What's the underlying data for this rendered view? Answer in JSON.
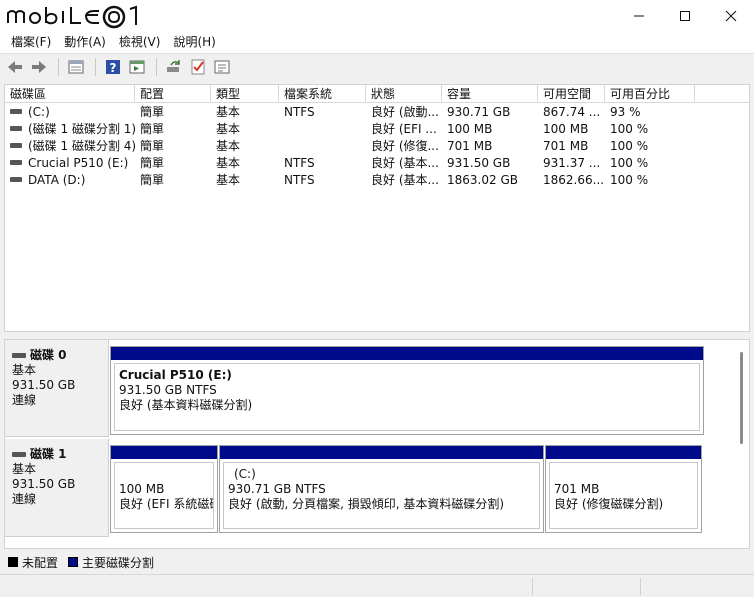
{
  "titlebar": {
    "brand": "mobile01"
  },
  "menu": [
    "檔案(F)",
    "動作(A)",
    "檢視(V)",
    "說明(H)"
  ],
  "toolbar_icons": [
    "back-arrow-icon",
    "forward-arrow-icon",
    "disk-list-icon",
    "help-icon",
    "properties-icon",
    "refresh-disk-icon",
    "check-icon",
    "settings-list-icon"
  ],
  "columns": [
    "磁碟區",
    "配置",
    "類型",
    "檔案系統",
    "狀態",
    "容量",
    "可用空間",
    "可用百分比"
  ],
  "rows": [
    [
      "(C:)",
      "簡單",
      "基本",
      "NTFS",
      "良好 (啟動...",
      "930.71 GB",
      "867.74 ...",
      "93 %"
    ],
    [
      "(磁碟 1 磁碟分割 1)",
      "簡單",
      "基本",
      "",
      "良好 (EFI ...",
      "100 MB",
      "100 MB",
      "100 %"
    ],
    [
      "(磁碟 1 磁碟分割 4)",
      "簡單",
      "基本",
      "",
      "良好 (修復...",
      "701 MB",
      "701 MB",
      "100 %"
    ],
    [
      "Crucial P510 (E:)",
      "簡單",
      "基本",
      "NTFS",
      "良好 (基本...",
      "931.50 GB",
      "931.37 ...",
      "100 %"
    ],
    [
      "DATA (D:)",
      "簡單",
      "基本",
      "NTFS",
      "良好 (基本...",
      "1863.02 GB",
      "1862.66...",
      "100 %"
    ]
  ],
  "disks": [
    {
      "name": "磁碟 0",
      "type": "基本",
      "size": "931.50 GB",
      "status": "連線",
      "partitions": [
        {
          "name": "Crucial P510  (E:)",
          "size_fs": "931.50 GB NTFS",
          "status": "良好 (基本資料磁碟分割)"
        }
      ]
    },
    {
      "name": "磁碟 1",
      "type": "基本",
      "size": "931.50 GB",
      "status": "連線",
      "partitions": [
        {
          "name": "",
          "size_fs": "100 MB",
          "status": "良好 (EFI 系統磁碟"
        },
        {
          "name": "(C:)",
          "size_fs": "930.71 GB NTFS",
          "status": "良好 (啟動, 分頁檔案, 損毀傾印, 基本資料磁碟分割)"
        },
        {
          "name": "",
          "size_fs": "701 MB",
          "status": "良好 (修復磁碟分割)"
        }
      ]
    }
  ],
  "legend": [
    {
      "label": "未配置",
      "color": "#000000"
    },
    {
      "label": "主要磁碟分割",
      "color": "#000b8c"
    }
  ],
  "colors": {
    "primary_partition": "#000b8c",
    "unallocated": "#000000"
  }
}
